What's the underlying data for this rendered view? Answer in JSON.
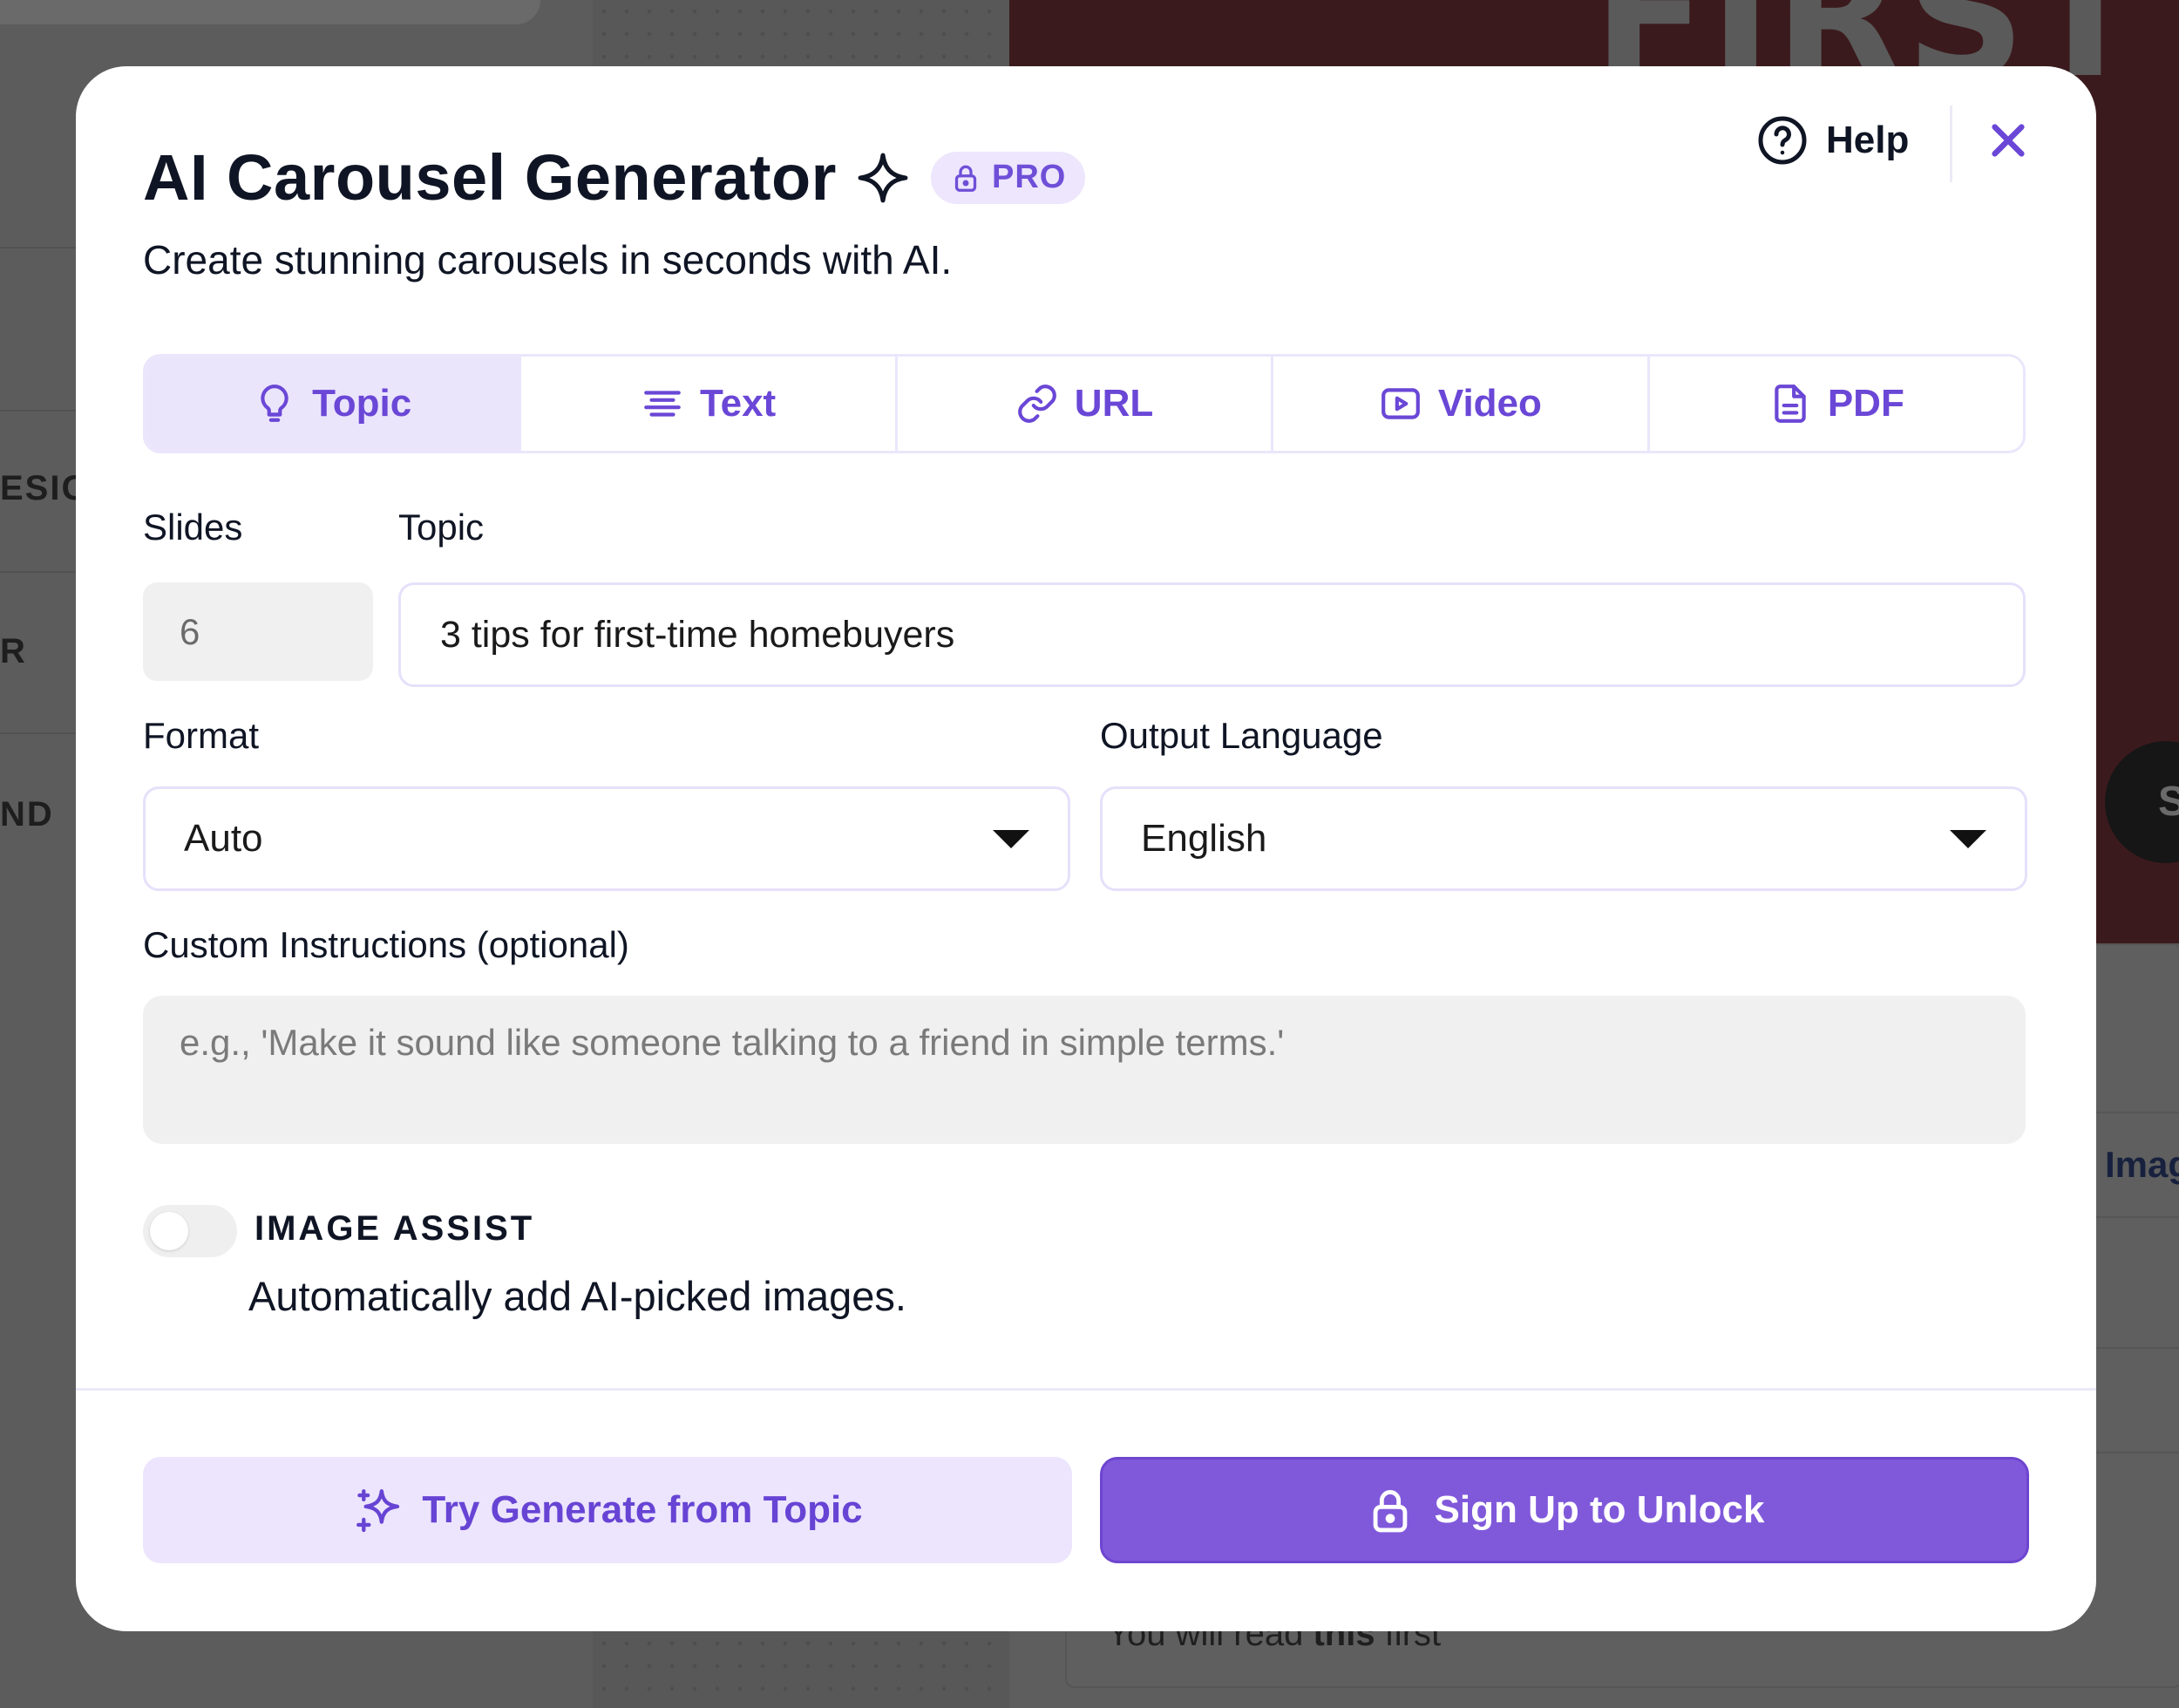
{
  "background": {
    "left_labels": [
      "ESIG",
      "R",
      "ND"
    ],
    "hero_word": "FIRST",
    "circle_letter": "S",
    "right_label": "Imag",
    "caption_prefix": "You will read ",
    "caption_bold": "this",
    "caption_suffix": " first"
  },
  "modal": {
    "title": "AI Carousel Generator",
    "badge": "PRO",
    "subtitle": "Create stunning carousels in seconds with AI.",
    "help_label": "Help",
    "tabs": [
      {
        "label": "Topic",
        "icon": "lightbulb-icon",
        "active": true
      },
      {
        "label": "Text",
        "icon": "text-lines-icon",
        "active": false
      },
      {
        "label": "URL",
        "icon": "link-icon",
        "active": false
      },
      {
        "label": "Video",
        "icon": "video-icon",
        "active": false
      },
      {
        "label": "PDF",
        "icon": "document-icon",
        "active": false
      }
    ],
    "slides_label": "Slides",
    "slides_value": "6",
    "topic_label": "Topic",
    "topic_value": "3 tips for first-time homebuyers",
    "format_label": "Format",
    "format_value": "Auto",
    "language_label": "Output Language",
    "language_value": "English",
    "custom_label": "Custom Instructions (optional)",
    "custom_placeholder": "e.g., 'Make it sound like someone talking to a friend in simple terms.'",
    "image_assist_title": "IMAGE ASSIST",
    "image_assist_desc": "Automatically add AI-picked images.",
    "image_assist_enabled": false,
    "try_button": "Try Generate from Topic",
    "unlock_button": "Sign Up to Unlock"
  },
  "colors": {
    "accent": "#6a47d6",
    "accent_light": "#ebe5fc",
    "primary_button": "#8059db",
    "text": "#0f1524"
  }
}
